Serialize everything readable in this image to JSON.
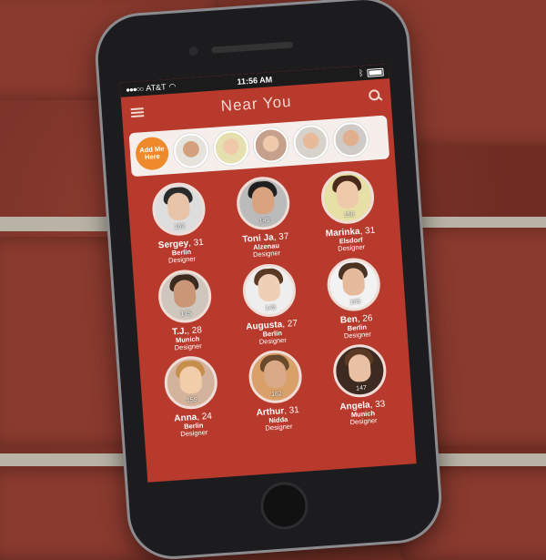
{
  "status_bar": {
    "carrier": "AT&T",
    "time": "11:56 AM"
  },
  "header": {
    "title": "Near You"
  },
  "strip": {
    "add_label": "Add Me Here"
  },
  "people": [
    {
      "name": "Sergey",
      "age": "31",
      "city": "Berlin",
      "role": "Designer",
      "count": "162",
      "skin": "#e7c3a8",
      "hair": "#2a2a2a",
      "bg": "#ddd"
    },
    {
      "name": "Toni Ja",
      "age": "37",
      "city": "Alzenau",
      "role": "Designer",
      "count": "145",
      "skin": "#d9a37f",
      "hair": "#1f1f1f",
      "bg": "#bbb"
    },
    {
      "name": "Marinka",
      "age": "31",
      "city": "Elsdorf",
      "role": "Designer",
      "count": "155",
      "skin": "#efcaa9",
      "hair": "#4a2a1b",
      "bg": "#e7e0a6"
    },
    {
      "name": "T.J.",
      "age": "28",
      "city": "Munich",
      "role": "Designer",
      "count": "175",
      "skin": "#c99778",
      "hair": "#3a2a20",
      "bg": "#cfc6bd"
    },
    {
      "name": "Augusta",
      "age": "27",
      "city": "Berlin",
      "role": "Designer",
      "count": "145",
      "skin": "#f0cfb7",
      "hair": "#5b3a25",
      "bg": "#eee"
    },
    {
      "name": "Ben",
      "age": "26",
      "city": "Berlin",
      "role": "Designer",
      "count": "165",
      "skin": "#e6bb9b",
      "hair": "#4b3324",
      "bg": "#f2f2f2"
    },
    {
      "name": "Anna",
      "age": "24",
      "city": "Berlin",
      "role": "Designer",
      "count": "155",
      "skin": "#f1cda9",
      "hair": "#c78d4b",
      "bg": "#d3b39b"
    },
    {
      "name": "Arthur",
      "age": "31",
      "city": "Nidda",
      "role": "Designer",
      "count": "162",
      "skin": "#d9a988",
      "hair": "#6b4a2c",
      "bg": "#d9a06a"
    },
    {
      "name": "Angela",
      "age": "33",
      "city": "Munich",
      "role": "Designer",
      "count": "147",
      "skin": "#e9c0a3",
      "hair": "#5a3a24",
      "bg": "#3d2a20"
    }
  ],
  "strip_faces": [
    {
      "skin": "#d2a07c",
      "bg": "#e6e2dc"
    },
    {
      "skin": "#efc9aa",
      "bg": "#e6e0b0"
    },
    {
      "skin": "#f0c8ac",
      "bg": "#c5a08a"
    },
    {
      "skin": "#e7bb9a",
      "bg": "#d7d2cb"
    },
    {
      "skin": "#e0b08e",
      "bg": "#cfcac5"
    }
  ]
}
